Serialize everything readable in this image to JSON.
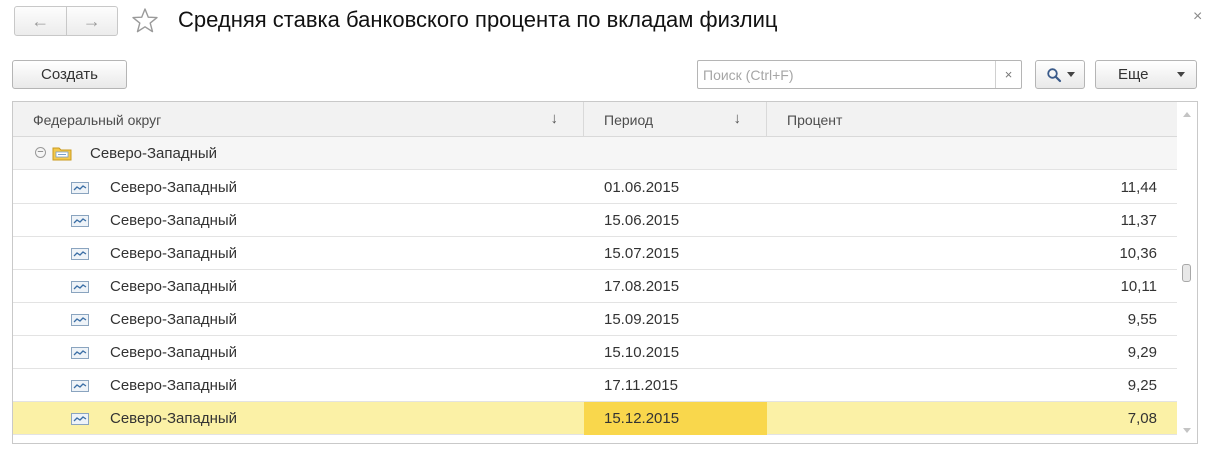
{
  "window": {
    "title": "Средняя ставка банковского процента по вкладам физлиц",
    "back_glyph": "←",
    "forward_glyph": "→",
    "close_glyph": "×",
    "favorite_icon": "star-icon"
  },
  "toolbar": {
    "create_label": "Создать",
    "search_placeholder": "Поиск (Ctrl+F)",
    "search_value": "",
    "clear_glyph": "×",
    "more_label": "Еще"
  },
  "table": {
    "columns": [
      {
        "label": "Федеральный округ",
        "sort": "↓"
      },
      {
        "label": "Период",
        "sort": "↓"
      },
      {
        "label": "Процент"
      }
    ],
    "group": {
      "label": "Северо-Западный",
      "expanded_glyph": "⊖"
    },
    "rows": [
      {
        "region": "Северо-Западный",
        "period": "01.06.2015",
        "percent": "11,44"
      },
      {
        "region": "Северо-Западный",
        "period": "15.06.2015",
        "percent": "11,37"
      },
      {
        "region": "Северо-Западный",
        "period": "15.07.2015",
        "percent": "10,36"
      },
      {
        "region": "Северо-Западный",
        "period": "17.08.2015",
        "percent": "10,11"
      },
      {
        "region": "Северо-Западный",
        "period": "15.09.2015",
        "percent": "9,55"
      },
      {
        "region": "Северо-Западный",
        "period": "15.10.2015",
        "percent": "9,29"
      },
      {
        "region": "Северо-Западный",
        "period": "17.11.2015",
        "percent": "9,25"
      },
      {
        "region": "Северо-Западный",
        "period": "15.12.2015",
        "percent": "7,08"
      }
    ],
    "selected_row_index": 7
  },
  "colors": {
    "selected_row": "#fbf1a6",
    "selected_cell": "#f9d74c",
    "header_bg": "#f2f2f2"
  }
}
